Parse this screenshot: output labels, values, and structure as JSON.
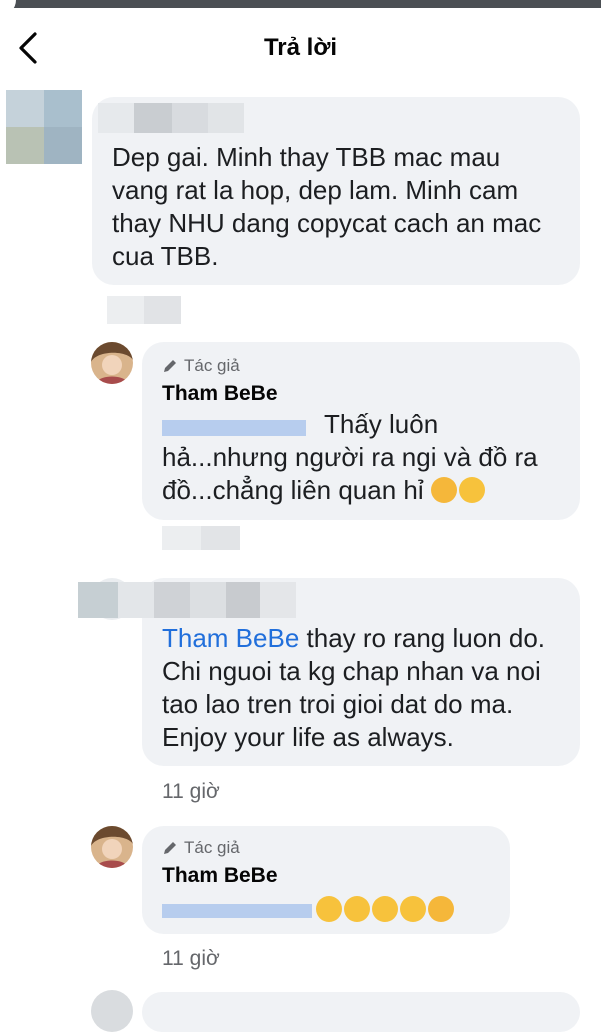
{
  "header": {
    "title": "Trả lời"
  },
  "comments": [
    {
      "text": "Dep gai.  Minh thay TBB mac mau\nvang rat la hop, dep lam.  Minh cam\nthay NHU dang copycat cach an mac\ncua TBB."
    },
    {
      "badge": "Tác giả",
      "author": "Tham BeBe",
      "text_tail": "Thấy luôn",
      "text_rest": "hả...nhưng người ra ngi và đồ ra\nđồ...chẳng liên quan hỉ",
      "emojis": [
        "smiling-face-with-hearts",
        "heart-eyes"
      ]
    },
    {
      "mention": "Tham BeBe",
      "text": " thay ro rang luon do.\nChi nguoi ta kg chap nhan va noi\ntao lao tren troi gioi dat do ma.\nEnjoy your life as always.",
      "time": "11 giờ"
    },
    {
      "badge": "Tác giả",
      "author": "Tham BeBe",
      "emojis": [
        "rolling-laughing",
        "rolling-laughing",
        "rolling-laughing",
        "rolling-laughing",
        "smiling-face-with-hearts"
      ],
      "time": "11 giờ"
    }
  ],
  "colors": {
    "bubble": "#f0f2f5",
    "mention": "#216fdb",
    "meta": "#65676b"
  }
}
